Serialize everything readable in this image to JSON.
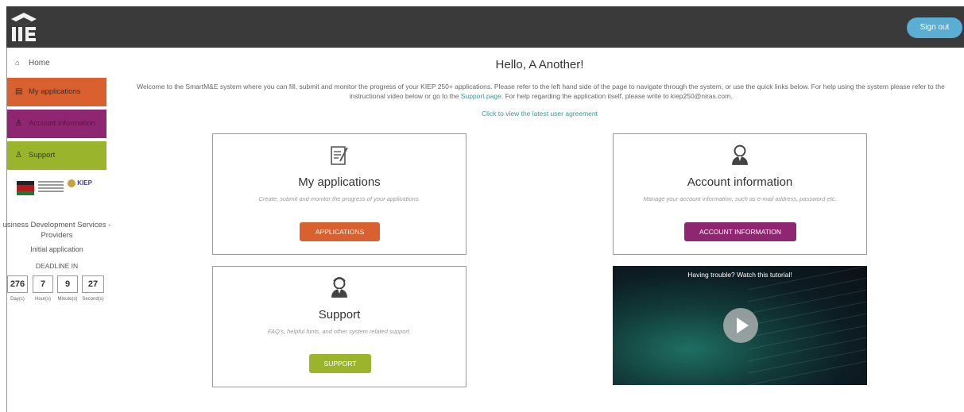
{
  "header": {
    "sign_out": "Sign out"
  },
  "sidebar": {
    "home": "Home",
    "my_applications": "My applications",
    "account_information": "Account information",
    "support": "Support",
    "program": "usiness Development Services - Providers",
    "application_type": "Initial application",
    "deadline_label": "DEADLINE IN",
    "countdown": {
      "days": "276",
      "hours": "7",
      "minutes": "9",
      "seconds": "27",
      "days_unit": "Day(s)",
      "hours_unit": "Hour(s)",
      "minutes_unit": "Minute(s)",
      "seconds_unit": "Second(s)"
    },
    "kiep_logo_text": "KIEP",
    "colors": {
      "apps": "#d9602f",
      "account": "#8e2671",
      "support": "#9ab52c"
    }
  },
  "main": {
    "greeting": "Hello, A Another!",
    "welcome_part1": "Welcome to the SmartM&E system where you can fill, submit and monitor the progress of your KIEP 250+ applications. Please refer to the left hand side of the page to navigate through the system, or use the quick links below. For help using the system please refer to the instructional video below or go to the ",
    "support_link": "Support page",
    "welcome_part2": ". For help regarding the application itself, please write to kiep250@niras.com.",
    "agreement_link": "Click to view the latest user agreement",
    "cards": {
      "applications": {
        "title": "My applications",
        "description": "Create, submit and monitor the progress of your applications.",
        "button": "APPLICATIONS",
        "icon": "document-edit-icon"
      },
      "account": {
        "title": "Account information",
        "description": "Manage your account information, such as e-mail address, password etc.",
        "button": "ACCOUNT INFORMATION",
        "icon": "user-icon"
      },
      "support": {
        "title": "Support",
        "description": "FAQ's, helpful hints, and other system related support.",
        "button": "SUPPORT",
        "icon": "support-user-icon"
      }
    },
    "video": {
      "caption": "Having trouble? Watch this tutorial!"
    },
    "colors": {
      "apps_button": "#d9602f",
      "account_button": "#8e2671",
      "support_button": "#9ab52c",
      "link": "#2e9b9b"
    }
  }
}
